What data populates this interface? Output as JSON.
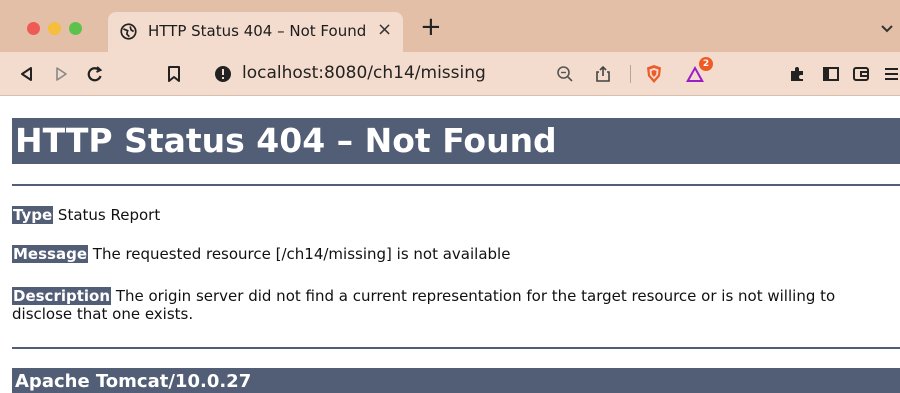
{
  "window": {
    "colors": {
      "red": "#ee5b55",
      "yellow": "#f5be3c",
      "green": "#5dc24d"
    }
  },
  "tab": {
    "title": "HTTP Status 404 – Not Found",
    "close": "×",
    "new_tab": "+"
  },
  "navbar": {
    "url": "localhost:8080/ch14/missing",
    "shields_badge": "2"
  },
  "page": {
    "heading": "HTTP Status 404 – Not Found",
    "type_label": "Type",
    "type_value": "Status Report",
    "message_label": "Message",
    "message_value": "The requested resource [/ch14/missing] is not available",
    "description_label": "Description",
    "description_value": "The origin server did not find a current representation for the target resource or is not willing to disclose that one exists.",
    "footer": "Apache Tomcat/10.0.27",
    "accent": "#525d76"
  }
}
